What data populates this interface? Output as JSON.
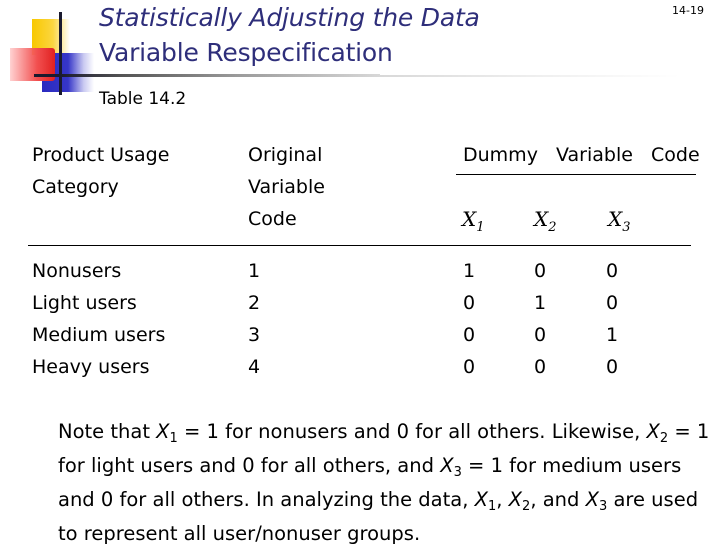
{
  "header": {
    "title": "Statistically Adjusting the Data",
    "subtitle": "Variable Respecification",
    "slide_number": "14-19"
  },
  "table": {
    "caption": "Table 14.2",
    "headers": {
      "category": [
        "Product Usage",
        "Category"
      ],
      "original_code": [
        "Original",
        "Variable",
        "Code"
      ],
      "dummy_group": "Dummy  Variable  Code",
      "dummy_vars": [
        {
          "base": "X",
          "sub": "1"
        },
        {
          "base": "X",
          "sub": "2"
        },
        {
          "base": "X",
          "sub": "3"
        }
      ]
    },
    "rows": [
      {
        "category": "Nonusers",
        "original": "1",
        "x1": "1",
        "x2": "0",
        "x3": "0"
      },
      {
        "category": "Light users",
        "original": "2",
        "x1": "0",
        "x2": "1",
        "x3": "0"
      },
      {
        "category": "Medium users",
        "original": "3",
        "x1": "0",
        "x2": "0",
        "x3": "1"
      },
      {
        "category": "Heavy users",
        "original": "4",
        "x1": "0",
        "x2": "0",
        "x3": "0"
      }
    ]
  },
  "note": {
    "p1": "Note that ",
    "v1": "X",
    "v1sub": "1",
    "p2": " = 1 for nonusers and 0 for all others.  Likewise, ",
    "v2": "X",
    "v2sub": "2",
    "p3": " = 1 for light users and 0 for all others, and ",
    "v3": "X",
    "v3sub": "3",
    "p4": " = 1 for medium users and 0 for all others.  In analyzing the data, ",
    "v4": "X",
    "v4sub": "1",
    "p5": ", ",
    "v5": "X",
    "v5sub": "2",
    "p6": ", and ",
    "v6": "X",
    "v6sub": "3",
    "p7": " are used to represent all user/nonuser groups."
  },
  "colors": {
    "title": "#2e2e7a",
    "logo_yellow": "#f8c800",
    "logo_red": "#e02020",
    "logo_blue": "#2a2abf"
  }
}
